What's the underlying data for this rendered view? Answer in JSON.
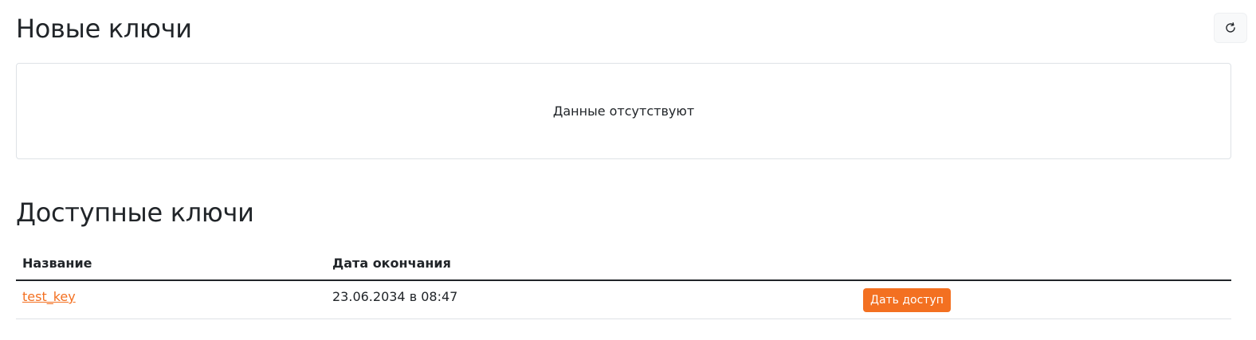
{
  "new_keys": {
    "title": "Новые ключи",
    "refresh_icon": "refresh-icon",
    "empty_text": "Данные отсутствуют"
  },
  "available_keys": {
    "title": "Доступные ключи",
    "columns": [
      "Название",
      "Дата окончания",
      ""
    ],
    "rows": [
      {
        "name": "test_key",
        "expiry": "23.06.2034 в 08:47",
        "action_label": "Дать доступ"
      }
    ]
  },
  "colors": {
    "accent": "#f37021",
    "text": "#212529",
    "border": "#dee2e6"
  }
}
